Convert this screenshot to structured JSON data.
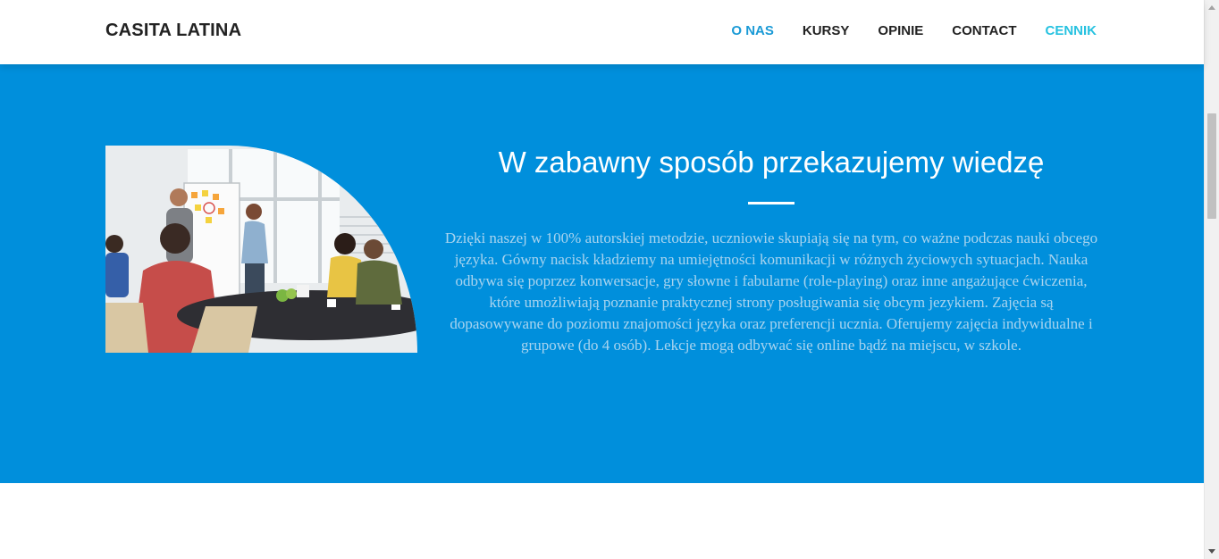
{
  "header": {
    "brand": "CASITA LATINA",
    "nav": [
      {
        "label": "O NAS",
        "color": "#1a9ad6"
      },
      {
        "label": "KURSY",
        "color": "#222222"
      },
      {
        "label": "OPINIE",
        "color": "#222222"
      },
      {
        "label": "CONTACT",
        "color": "#222222"
      },
      {
        "label": "CENNIK",
        "color": "#27c2e0"
      }
    ]
  },
  "hero": {
    "background": "#008fdc",
    "title": "W zabawny sposób przekazujemy wiedzę",
    "text": "Dzięki naszej w 100% autorskiej metodzie, uczniowie skupiają się na tym, co ważne podczas nauki obcego języka. Gówny nacisk kładziemy na umiejętności komunikacji w różnych życiowych sytuacjach. Nauka odbywa się poprzez konwersacje, gry słowne i fabularne (role-playing) oraz inne angażujące ćwiczenia, które umożliwiają poznanie praktycznej strony posługiwania się obcym jezykiem. Zajęcia są dopasowywane do poziomu znajomości języka oraz preferencji ucznia. Oferujemy zajęcia indywidualne i grupowe (do 4 osób). Lekcje mogą odbywać się online bądź na miejscu, w szkole.",
    "image": "classroom-photo"
  }
}
